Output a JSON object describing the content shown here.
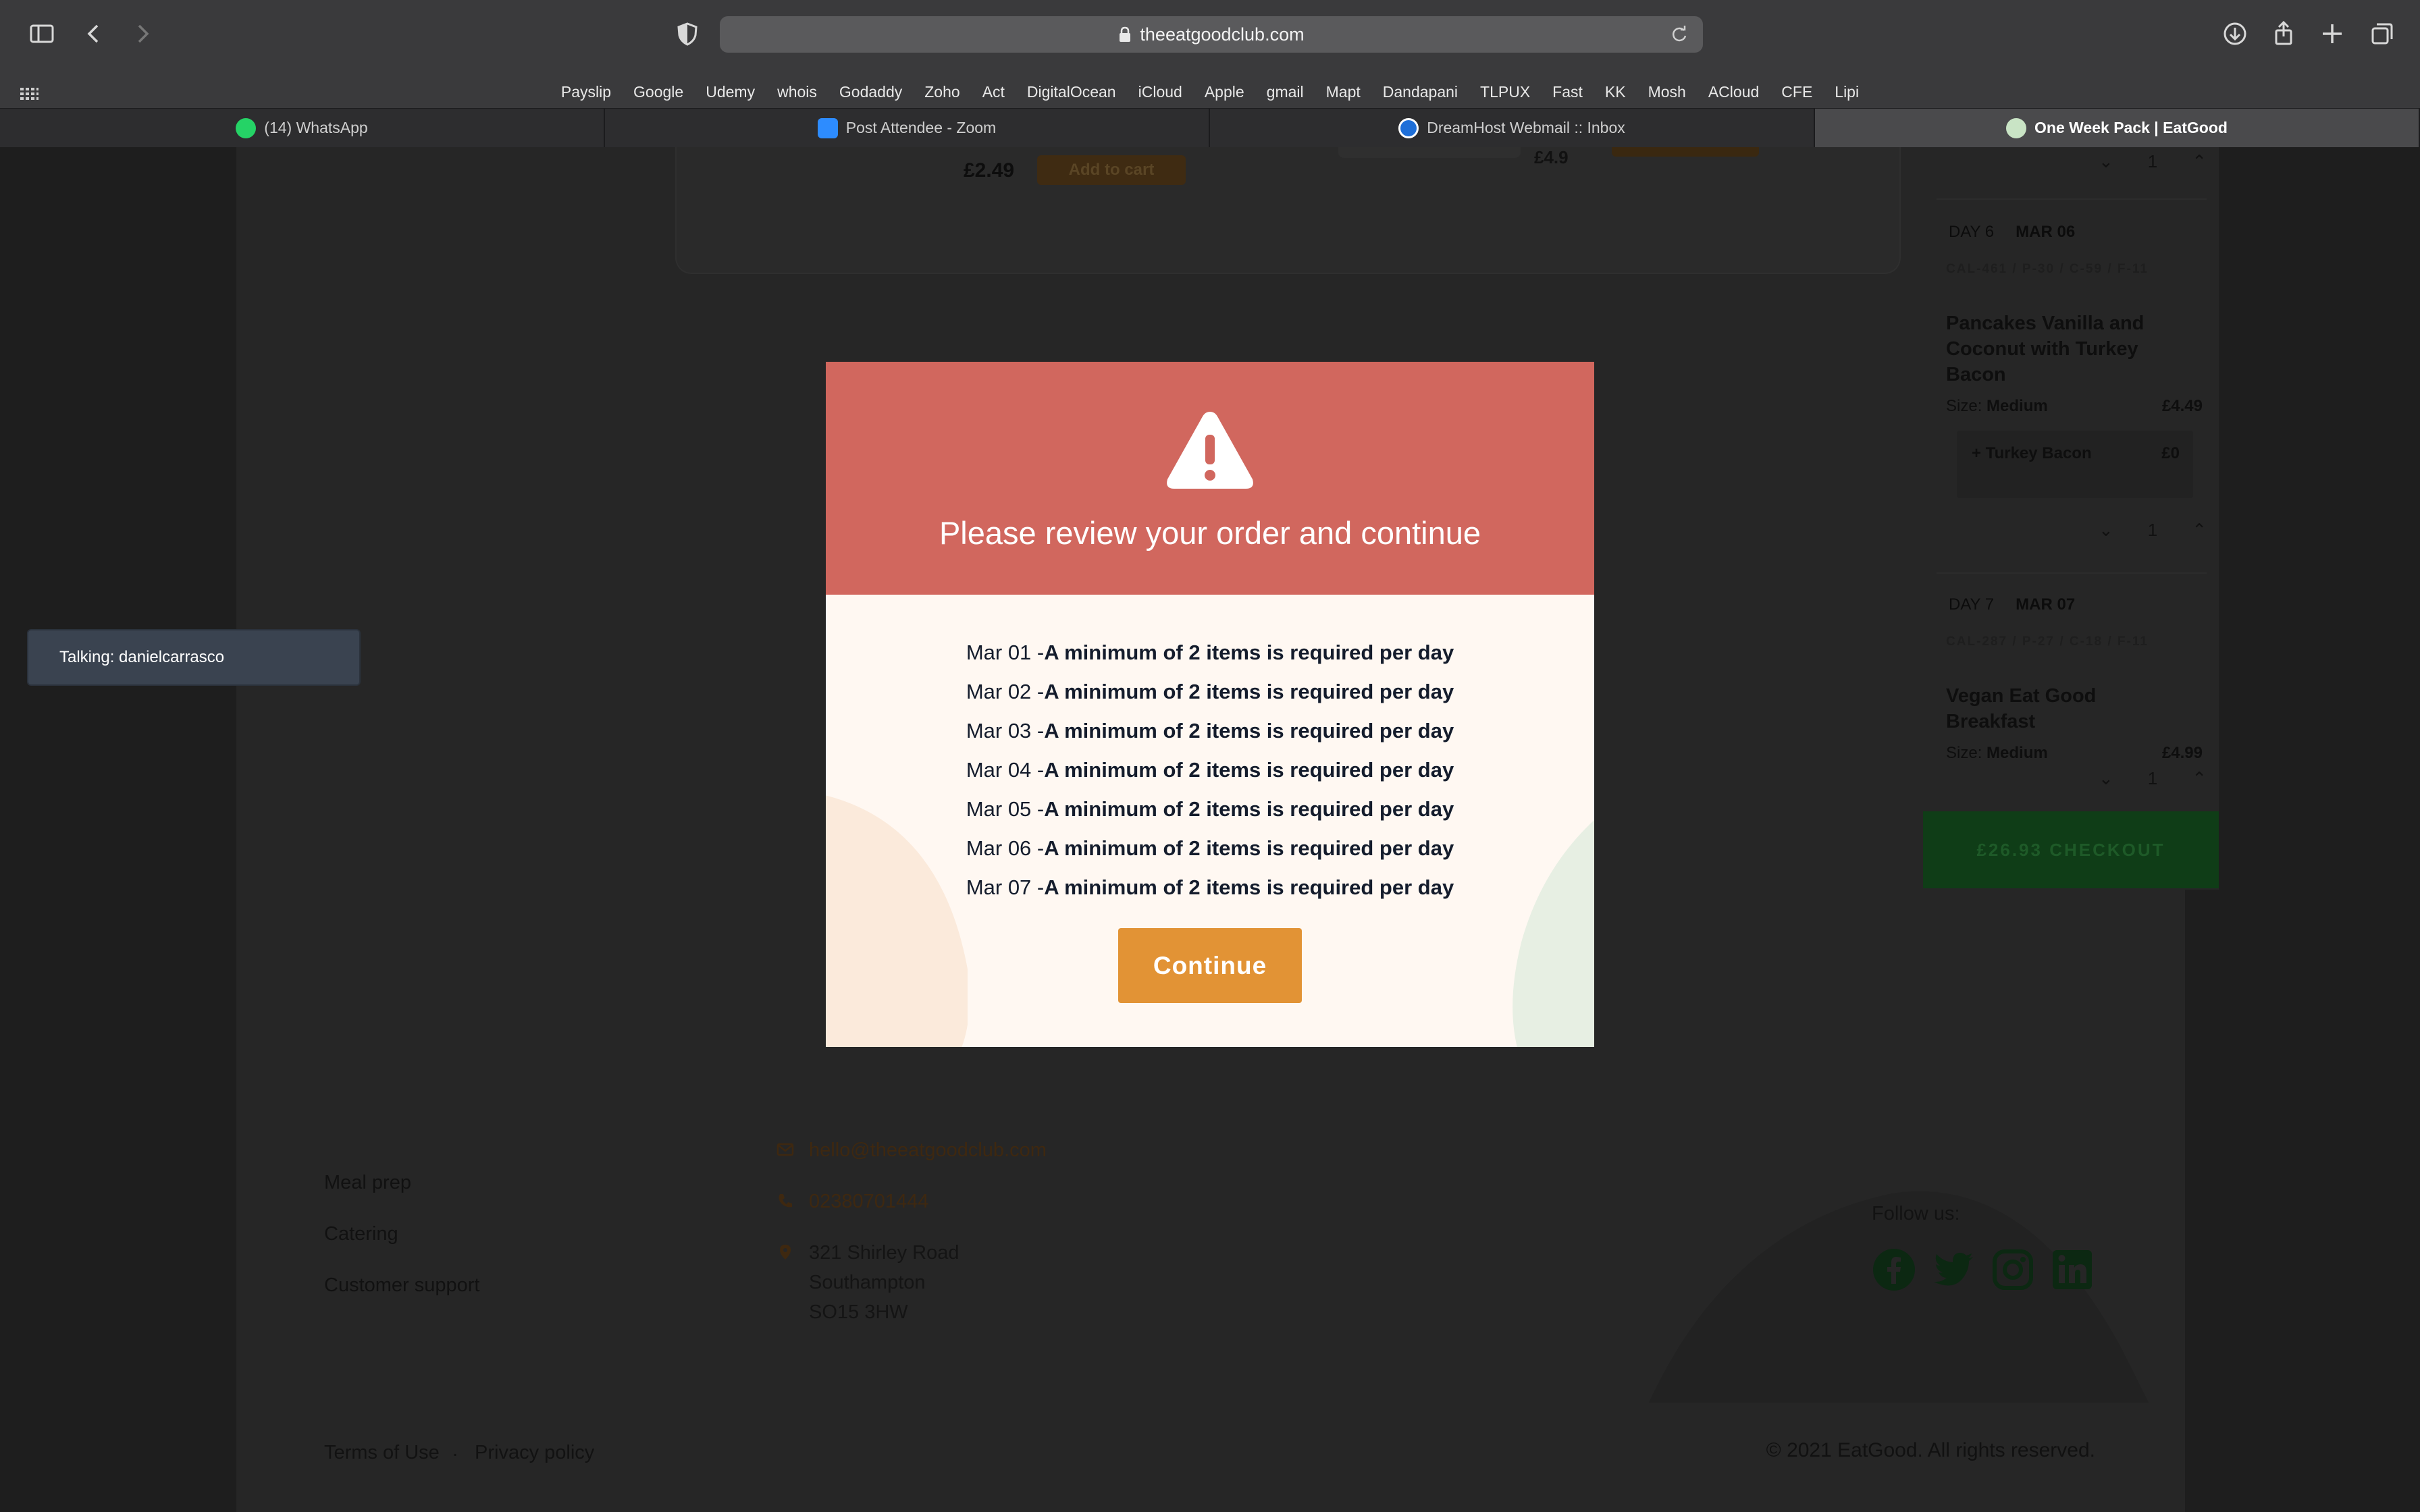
{
  "browser": {
    "url": "theeatgoodclub.com",
    "bookmarks": [
      "Payslip",
      "Google",
      "Udemy",
      "whois",
      "Godaddy",
      "Zoho",
      "Act",
      "DigitalOcean",
      "iCloud",
      "Apple",
      "gmail",
      "Mapt",
      "Dandapani",
      "TLPUX",
      "Fast",
      "KK",
      "Mosh",
      "ACloud",
      "CFE",
      "Lipi"
    ],
    "tabs": [
      {
        "label": "(14) WhatsApp",
        "icon": "whatsapp-icon",
        "color": "#25d366"
      },
      {
        "label": "Post Attendee - Zoom",
        "icon": "zoom-icon",
        "color": "#2d8cff"
      },
      {
        "label": "DreamHost Webmail :: Inbox",
        "icon": "dreamhost-icon",
        "color": "#1e6fd9"
      },
      {
        "label": "One Week Pack | EatGood",
        "icon": "eatgood-icon",
        "color": "#c9e4c5",
        "active": true
      }
    ]
  },
  "product": {
    "price": "£2.49",
    "add_to_cart": "Add to cart",
    "ghost_price": "£4.9"
  },
  "cart": {
    "days": [
      {
        "day": "DAY 6",
        "date": "MAR 06",
        "macros": "CAL-461 / P-30 / C-59 / F-11",
        "meal": "Pancakes Vanilla and Coconut with Turkey Bacon",
        "size_label": "Size:",
        "size": "Medium",
        "price": "£4.49",
        "addon": "+ Turkey Bacon",
        "addon_price": "£0",
        "qty": "1"
      },
      {
        "day": "DAY 7",
        "date": "MAR 07",
        "macros": "CAL-287 / P-27 / C-18 / F-11",
        "meal": "Vegan Eat Good Breakfast",
        "size_label": "Size:",
        "size": "Medium",
        "price": "£4.99",
        "qty": "1"
      }
    ],
    "top_qty": "1",
    "checkout": "£26.93  CHECKOUT"
  },
  "footer": {
    "links": [
      "Meal prep",
      "Catering",
      "Customer support"
    ],
    "email": "hello@theeatgoodclub.com",
    "phone": "02380701444",
    "address": [
      "321 Shirley Road",
      "Southampton",
      "SO15 3HW"
    ],
    "follow": "Follow us:",
    "terms": "Terms of Use",
    "separator": ".",
    "privacy": "Privacy policy",
    "copyright": "© 2021 EatGood. All rights reserved."
  },
  "zoom": {
    "talking": "Talking: danielcarrasco"
  },
  "modal": {
    "title": "Please review your order and continue",
    "messages": [
      {
        "date": "Mar 01 -",
        "text": "A minimum of 2 items is required per day"
      },
      {
        "date": "Mar 02 -",
        "text": "A minimum of 2 items is required per day"
      },
      {
        "date": "Mar 03 -",
        "text": "A minimum of 2 items is required per day"
      },
      {
        "date": "Mar 04 -",
        "text": "A minimum of 2 items is required per day"
      },
      {
        "date": "Mar 05 -",
        "text": "A minimum of 2 items is required per day"
      },
      {
        "date": "Mar 06 -",
        "text": "A minimum of 2 items is required per day"
      },
      {
        "date": "Mar 07 -",
        "text": "A minimum of 2 items is required per day"
      }
    ],
    "continue_label": "Continue",
    "colors": {
      "header": "#d1675e",
      "button": "#e29335",
      "body": "#fff8f2"
    }
  }
}
